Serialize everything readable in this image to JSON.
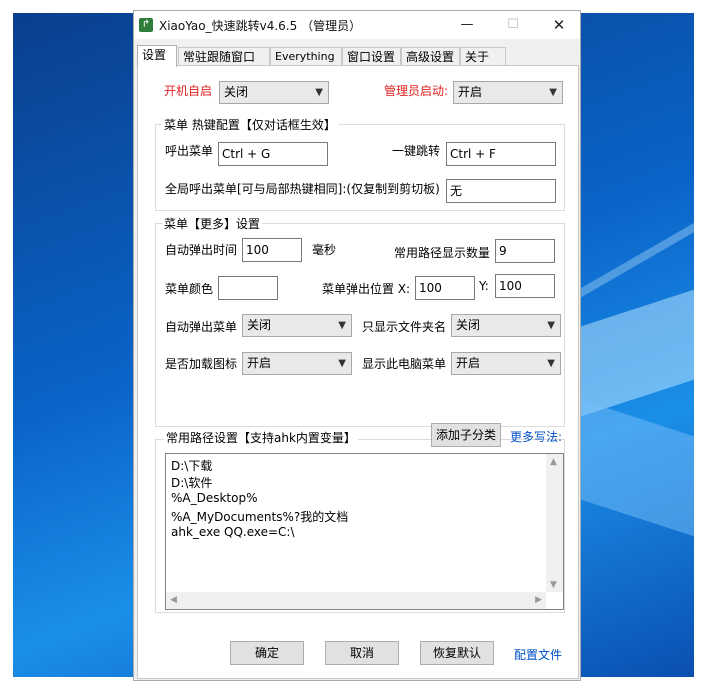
{
  "window": {
    "title": "XiaoYao_快速跳转v4.6.5 （管理员）",
    "minimize": "—",
    "maximize": "☐",
    "close": "✕"
  },
  "tabs": [
    "设置",
    "常驻跟随窗口",
    "Everything",
    "窗口设置",
    "高级设置",
    "关于"
  ],
  "top": {
    "autostart_label": "开机自启",
    "autostart_value": "关闭",
    "admin_label": "管理员启动:",
    "admin_value": "开启"
  },
  "hotkey_group": {
    "title": "菜单 热键配置【仅对话框生效】",
    "call_menu_label": "呼出菜单",
    "call_menu_value": "Ctrl + G",
    "jump_label": "一键跳转",
    "jump_value": "Ctrl + F",
    "global_label": "全局呼出菜单[可与局部热键相同]:(仅复制到剪切板)",
    "global_value": "无"
  },
  "more_group": {
    "title": "菜单【更多】设置",
    "auto_popup_time_label": "自动弹出时间",
    "auto_popup_time_value": "100",
    "ms_label": "毫秒",
    "path_count_label": "常用路径显示数量",
    "path_count_value": "9",
    "color_label": "菜单颜色",
    "color_value": "",
    "popup_pos_label": "菜单弹出位置 X:",
    "popup_x_value": "100",
    "y_label": "Y:",
    "popup_y_value": "100",
    "auto_popup_label": "自动弹出菜单",
    "auto_popup_value": "关闭",
    "folder_only_label": "只显示文件夹名",
    "folder_only_value": "关闭",
    "load_icon_label": "是否加载图标",
    "load_icon_value": "开启",
    "pc_menu_label": "显示此电脑菜单",
    "pc_menu_value": "开启"
  },
  "paths": {
    "title": "常用路径设置【支持ahk内置变量】",
    "add_sub_button": "添加子分类",
    "more_link": "更多写法:",
    "lines": [
      "D:\\下载",
      "D:\\软件",
      "%A_Desktop%",
      "%A_MyDocuments%?我的文档",
      "ahk_exe QQ.exe=C:\\"
    ]
  },
  "footer": {
    "ok": "确定",
    "cancel": "取消",
    "restore": "恢复默认",
    "config_link": "配置文件"
  },
  "colors": {
    "accent_red": "#e02020",
    "link_blue": "#0050c8",
    "desktop_blue": "#0a64c8"
  }
}
